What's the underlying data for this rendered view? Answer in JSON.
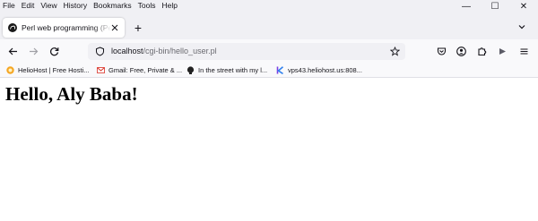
{
  "menubar": {
    "items": [
      "File",
      "Edit",
      "View",
      "History",
      "Bookmarks",
      "Tools",
      "Help"
    ]
  },
  "window_controls": {
    "minimize": "—",
    "maximize": "☐",
    "close": "✕"
  },
  "tab": {
    "title": "Perl web programming (Perl scripts)",
    "icon": "perl-camel-icon"
  },
  "new_tab": {
    "label": "+"
  },
  "url": {
    "host": "localhost",
    "path": "/cgi-bin/hello_user.pl"
  },
  "bookmarks": [
    {
      "label": "HelioHost | Free Hosti...",
      "icon": "heliohost-icon",
      "color": "#f5a623"
    },
    {
      "label": "Gmail: Free, Private & ...",
      "icon": "gmail-icon",
      "color": "#d93025"
    },
    {
      "label": "In the street with my l...",
      "icon": "head-icon",
      "color": "#222222"
    },
    {
      "label": "vps43.heliohost.us:808...",
      "icon": "k-logo-icon",
      "color": "#7b3fe4"
    }
  ],
  "page": {
    "heading": "Hello, Aly Baba!"
  },
  "colors": {
    "chrome": "#f0f0f4",
    "toolbar": "#f9f9fb",
    "content": "#ffffff"
  }
}
